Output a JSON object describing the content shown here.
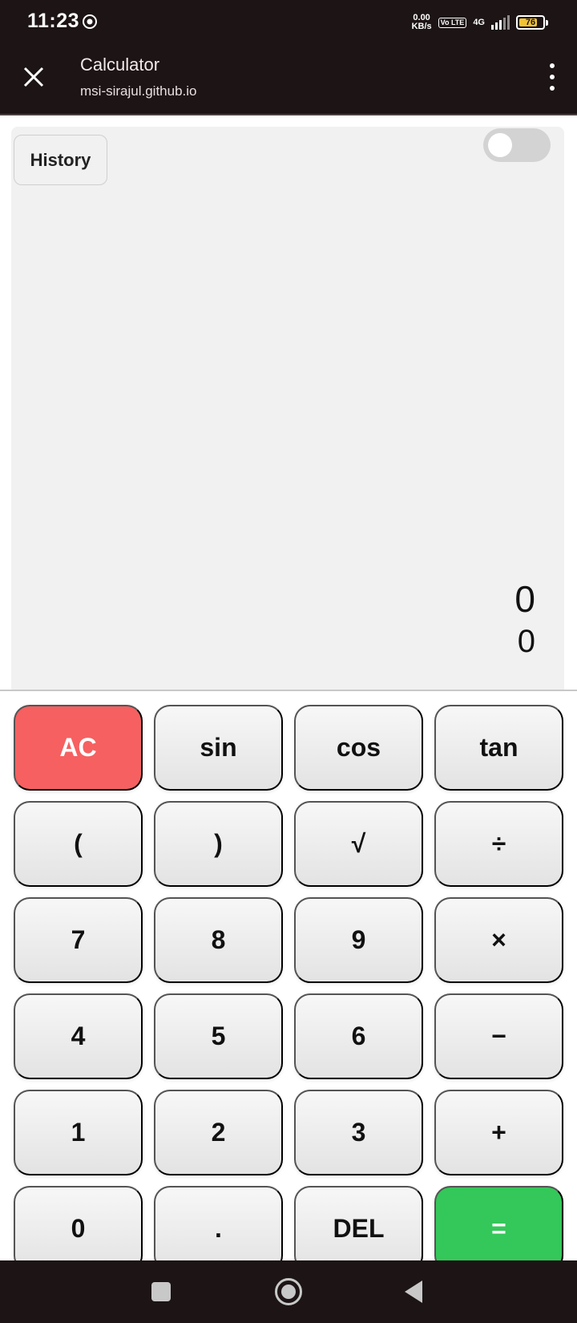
{
  "status_bar": {
    "time": "11:23",
    "net_speed_value": "0.00",
    "net_speed_unit": "KB/s",
    "volte": "Vo LTE",
    "network": "4G",
    "battery": "76",
    "colors": {
      "background": "#1c1415",
      "battery_fill": "#f2c335"
    }
  },
  "toolbar": {
    "title": "Calculator",
    "url": "msi-sirajul.github.io"
  },
  "calculator": {
    "history_label": "History",
    "theme_toggle_on": false,
    "expression": "0",
    "result": "0",
    "keys": [
      [
        "AC",
        "sin",
        "cos",
        "tan"
      ],
      [
        "(",
        ")",
        "√",
        "÷"
      ],
      [
        "7",
        "8",
        "9",
        "×"
      ],
      [
        "4",
        "5",
        "6",
        "−"
      ],
      [
        "1",
        "2",
        "3",
        "+"
      ],
      [
        "0",
        ".",
        "DEL",
        "="
      ]
    ],
    "colors": {
      "clear_key": "#f66060",
      "equals_key": "#34c759",
      "display_bg": "#f1f1f1"
    }
  },
  "nav_bar": {
    "icons": [
      "recents-icon",
      "home-icon",
      "back-icon"
    ]
  }
}
